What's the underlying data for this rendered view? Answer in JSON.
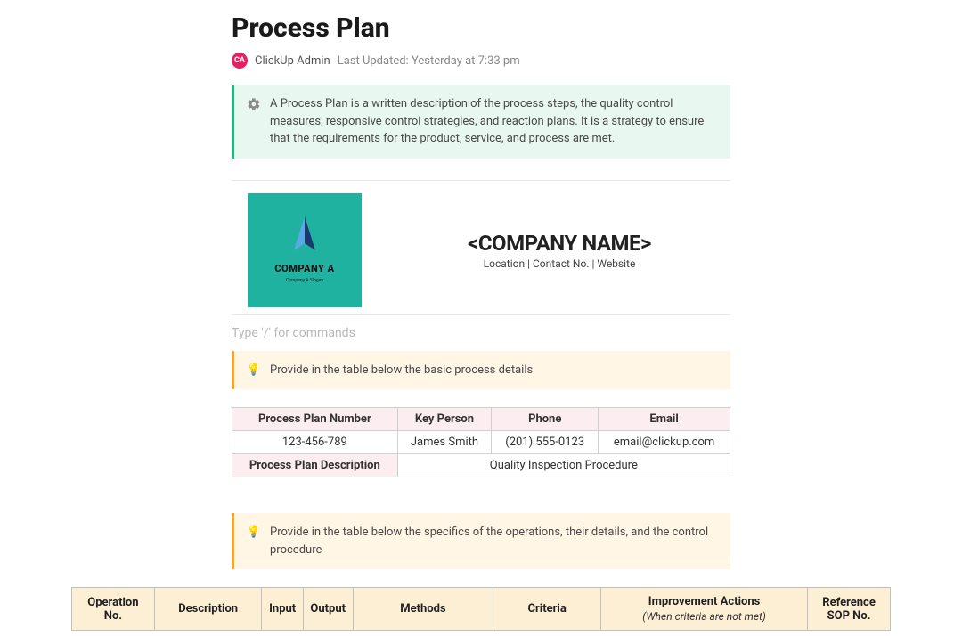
{
  "header": {
    "title": "Process Plan",
    "avatar_initials": "CA",
    "author": "ClickUp Admin",
    "updated_label": "Last Updated:",
    "updated_value": "Yesterday at 7:33 pm"
  },
  "intro_callout": {
    "text": "A Process Plan is a written description of the process steps, the quality control measures, responsive control strategies, and reaction plans. It is a strategy to ensure that the requirements for the product, service, and process are met."
  },
  "company": {
    "logo_name": "COMPANY A",
    "logo_slogan": "Company A Slogan",
    "placeholder_title": "<COMPANY NAME>",
    "subline": "Location | Contact No. | Website"
  },
  "slash_hint": "Type '/' for commands",
  "callout_details": {
    "text": "Provide in the table below the basic process details"
  },
  "details_table": {
    "headers": {
      "plan_number": "Process Plan Number",
      "key_person": "Key Person",
      "phone": "Phone",
      "email": "Email",
      "description_label": "Process Plan Description"
    },
    "values": {
      "plan_number": "123-456-789",
      "key_person": "James Smith",
      "phone": "(201) 555-0123",
      "email": "email@clickup.com",
      "description": "Quality Inspection Procedure"
    }
  },
  "callout_ops": {
    "text": "Provide in the table below the specifics of the operations, their details, and the control procedure"
  },
  "ops_table": {
    "headers": {
      "op_no": "Operation No.",
      "description": "Description",
      "input": "Input",
      "output": "Output",
      "methods": "Methods",
      "criteria": "Criteria",
      "improvement": "Improvement Actions",
      "improvement_sub": "(When criteria are not met)",
      "reference": "Reference SOP No."
    }
  }
}
